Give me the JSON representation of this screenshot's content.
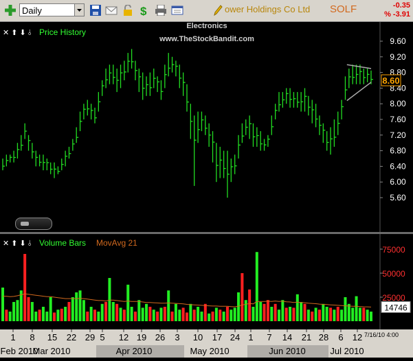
{
  "toolbar": {
    "period": "Daily",
    "company": "ower Holdings Co Ltd",
    "symbol": "SOLF",
    "change": "-0.35",
    "change_pct": "% -3.91"
  },
  "price_panel": {
    "controls": "✕ ⬆ ⬇ ⫰",
    "label": "Price History",
    "sector": "Electronics",
    "site": "www.TheStockBandit.com",
    "last_price": "8.60"
  },
  "volume_panel": {
    "controls": "✕ ⬆ ⬇ ⫰",
    "label": "Volume Bars",
    "ma_label": "MovAvg 21",
    "last_volume": "14746"
  },
  "date_axis": {
    "day_ticks": [
      "1",
      "8",
      "15",
      "22",
      "29",
      "5",
      "12",
      "19",
      "26",
      "3",
      "10",
      "17",
      "24",
      "1",
      "7",
      "14",
      "21",
      "28",
      "6",
      "12"
    ],
    "months": [
      "Feb 2010",
      "Mar 2010",
      "Apr 2010",
      "May 2010",
      "Jun 2010",
      "Jul 2010"
    ],
    "stamp_date": "7/16/10",
    "stamp_time": "4:00"
  },
  "chart_data": [
    {
      "type": "ohlc",
      "title": "Price History",
      "y_ticks": [
        9.6,
        9.2,
        8.8,
        8.4,
        8.0,
        7.6,
        7.2,
        6.8,
        6.4,
        6.0,
        5.6
      ],
      "ylim": [
        5.4,
        9.8
      ],
      "bars_high": [
        6.6,
        6.7,
        6.7,
        6.8,
        7.0,
        7.2,
        7.5,
        7.2,
        7.0,
        6.8,
        6.7,
        6.7,
        6.6,
        6.5,
        6.5,
        6.4,
        6.6,
        6.8,
        6.9,
        7.1,
        7.4,
        7.8,
        8.0,
        8.1,
        8.0,
        7.9,
        8.3,
        8.6,
        8.9,
        9.0,
        9.0,
        8.9,
        9.0,
        9.1,
        9.3,
        9.4,
        9.1,
        8.9,
        8.8,
        8.7,
        8.8,
        8.9,
        8.7,
        8.6,
        9.0,
        9.3,
        9.2,
        9.1,
        9.0,
        8.8,
        8.5,
        8.0,
        7.7,
        7.8,
        7.8,
        7.7,
        7.5,
        7.3,
        7.0,
        6.9,
        6.8,
        6.8,
        6.6,
        6.7,
        7.2,
        7.5,
        7.6,
        7.7,
        7.5,
        7.4,
        7.3,
        7.1,
        7.2,
        7.7,
        8.0,
        8.3,
        8.3,
        8.4,
        8.4,
        8.3,
        8.3,
        8.3,
        8.4,
        8.2,
        8.1,
        8.0,
        7.7,
        7.5,
        7.3,
        7.4,
        7.6,
        7.8,
        8.1,
        8.7,
        8.9,
        9.0,
        9.0,
        9.0,
        8.9,
        8.9,
        8.85
      ],
      "bars_low": [
        6.3,
        6.4,
        6.5,
        6.5,
        6.6,
        6.8,
        7.1,
        6.8,
        6.6,
        6.4,
        6.4,
        6.3,
        6.3,
        6.2,
        6.1,
        6.2,
        6.3,
        6.4,
        6.6,
        6.8,
        7.0,
        7.3,
        7.6,
        7.7,
        7.6,
        7.5,
        7.8,
        8.2,
        8.4,
        8.5,
        8.5,
        8.3,
        8.4,
        8.6,
        8.8,
        8.9,
        8.6,
        8.3,
        8.1,
        8.2,
        8.2,
        8.4,
        8.3,
        8.1,
        8.4,
        8.7,
        8.8,
        8.7,
        8.4,
        8.2,
        7.8,
        7.1,
        5.9,
        7.0,
        7.3,
        7.2,
        6.9,
        6.5,
        6.0,
        6.1,
        6.1,
        5.6,
        6.0,
        6.2,
        6.6,
        7.0,
        7.2,
        7.1,
        6.9,
        6.9,
        6.8,
        6.8,
        6.9,
        7.2,
        7.6,
        7.8,
        7.9,
        8.0,
        7.9,
        7.9,
        7.9,
        7.8,
        7.8,
        7.7,
        7.5,
        7.4,
        7.2,
        7.0,
        6.8,
        6.7,
        6.9,
        7.2,
        7.6,
        8.1,
        8.4,
        8.5,
        8.5,
        8.5,
        8.5,
        8.55,
        8.5
      ],
      "close": 8.6,
      "pattern": "triangle"
    },
    {
      "type": "bar",
      "title": "Volume Bars",
      "series_names": [
        "Volume Bars",
        "MovAvg 21"
      ],
      "y_ticks": [
        75000,
        50000,
        25000
      ],
      "ylim": [
        0,
        90000
      ],
      "colors": {
        "up": "#22ee22",
        "down": "#ff2020",
        "ma": "#d2691e",
        "axis": "#ff3030"
      },
      "volume": [
        35000,
        12000,
        10000,
        20000,
        22000,
        32000,
        70000,
        25000,
        20000,
        10000,
        12000,
        15000,
        10000,
        25000,
        9000,
        12000,
        13000,
        15000,
        20000,
        25000,
        30000,
        32000,
        22000,
        10000,
        15000,
        12000,
        10000,
        18000,
        20000,
        45000,
        20000,
        18000,
        14000,
        12000,
        38000,
        15000,
        10000,
        22000,
        14000,
        18000,
        15000,
        12000,
        10000,
        14000,
        15000,
        32000,
        10000,
        18000,
        12000,
        14000,
        9000,
        18000,
        12000,
        15000,
        10000,
        18000,
        8000,
        10000,
        14000,
        12000,
        10000,
        15000,
        12000,
        14000,
        30000,
        50000,
        22000,
        33000,
        15000,
        72000,
        20000,
        18000,
        22000,
        15000,
        18000,
        12000,
        22000,
        14000,
        15000,
        14000,
        28000,
        20000,
        18000,
        12000,
        10000,
        14000,
        12000,
        18000,
        15000,
        14000,
        12000,
        15000,
        12000,
        25000,
        18000,
        14000,
        26000,
        14000,
        14000,
        12000,
        10000
      ],
      "up": [
        1,
        0,
        1,
        1,
        1,
        1,
        0,
        0,
        1,
        1,
        0,
        1,
        1,
        1,
        0,
        1,
        0,
        1,
        0,
        1,
        1,
        1,
        1,
        0,
        1,
        0,
        1,
        1,
        0,
        1,
        1,
        0,
        1,
        0,
        1,
        1,
        0,
        1,
        1,
        1,
        0,
        1,
        0,
        1,
        0,
        1,
        0,
        1,
        1,
        0,
        0,
        1,
        0,
        1,
        1,
        0,
        1,
        0,
        1,
        0,
        1,
        0,
        1,
        1,
        1,
        0,
        1,
        0,
        1,
        1,
        1,
        0,
        0,
        1,
        0,
        1,
        1,
        0,
        1,
        0,
        1,
        1,
        0,
        1,
        0,
        1,
        0,
        1,
        1,
        0,
        1,
        0,
        1,
        1,
        1,
        1,
        1,
        1,
        0,
        1,
        1
      ],
      "ma": [
        26000,
        26000,
        25500,
        25800,
        26500,
        27500,
        28500,
        28000,
        27500,
        27000,
        26500,
        26000,
        25500,
        25500,
        25000,
        24500,
        24000,
        23500,
        23500,
        23500,
        23500,
        23800,
        23500,
        23000,
        22500,
        22000,
        21500,
        21500,
        21000,
        22000,
        22000,
        21500,
        21000,
        20500,
        21000,
        20500,
        20500,
        20500,
        20000,
        19500,
        19500,
        19200,
        19000,
        18800,
        18800,
        19000,
        18800,
        18500,
        18300,
        18000,
        17500,
        17200,
        17000,
        16800,
        16500,
        16300,
        16000,
        15800,
        15800,
        15600,
        15500,
        15500,
        15200,
        15000,
        15500,
        17000,
        17500,
        18500,
        18000,
        20500,
        20500,
        20500,
        20800,
        20500,
        21000,
        20500,
        20800,
        20200,
        20000,
        19500,
        19800,
        19500,
        19200,
        18800,
        18500,
        18200,
        17800,
        17500,
        17300,
        17000,
        16800,
        16500,
        16200,
        16000,
        15800,
        15500,
        15500,
        15200,
        15000,
        14900,
        14746
      ]
    }
  ]
}
